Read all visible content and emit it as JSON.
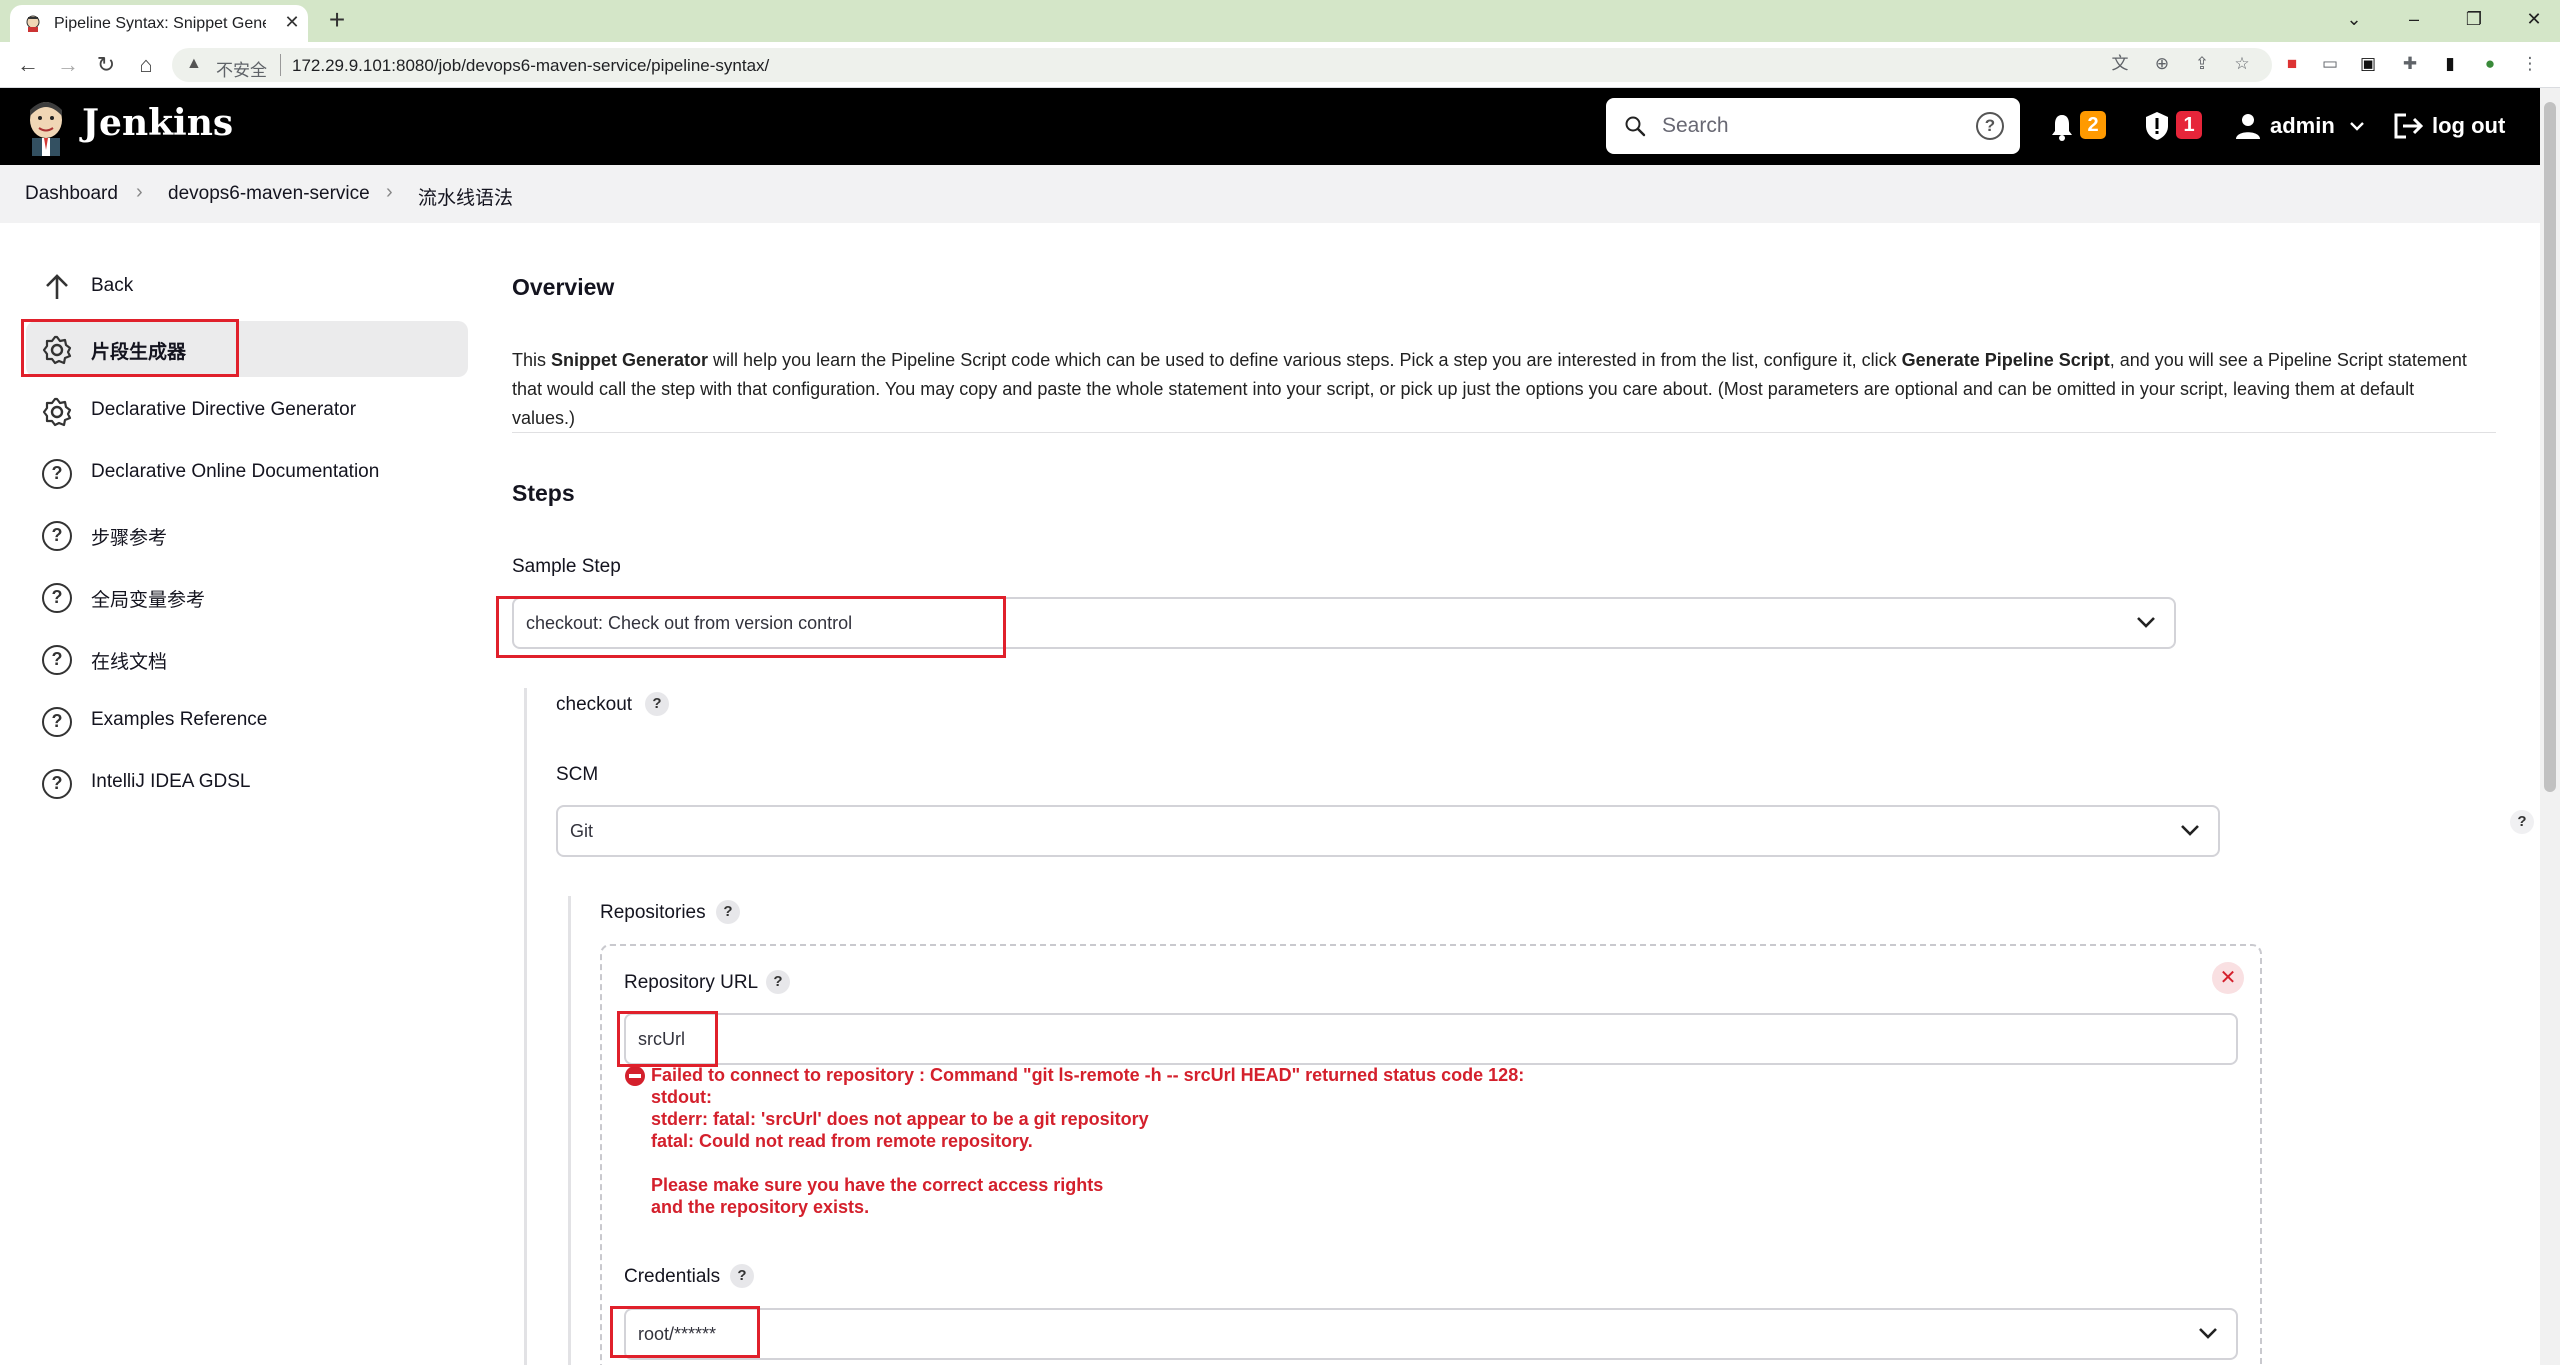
{
  "browser": {
    "tab_title": "Pipeline Syntax: Snippet Generator",
    "security_label": "不安全",
    "url": "172.29.9.101:8080/job/devops6-maven-service/pipeline-syntax/"
  },
  "header": {
    "brand": "Jenkins",
    "search_placeholder": "Search",
    "notifications_count": "2",
    "security_count": "1",
    "user": "admin",
    "logout": "log out"
  },
  "breadcrumb": [
    "Dashboard",
    "devops6-maven-service",
    "流水线语法"
  ],
  "sidebar": {
    "items": [
      {
        "label": "Back"
      },
      {
        "label": "片段生成器"
      },
      {
        "label": "Declarative Directive Generator"
      },
      {
        "label": "Declarative Online Documentation"
      },
      {
        "label": "步骤参考"
      },
      {
        "label": "全局变量参考"
      },
      {
        "label": "在线文档"
      },
      {
        "label": "Examples Reference"
      },
      {
        "label": "IntelliJ IDEA GDSL"
      }
    ]
  },
  "main": {
    "overview_title": "Overview",
    "overview_p1": "This ",
    "overview_b1": "Snippet Generator",
    "overview_p2": " will help you learn the Pipeline Script code which can be used to define various steps. Pick a step you are interested in from the list, configure it, click ",
    "overview_b2": "Generate Pipeline Script",
    "overview_p3": ", and you will see a Pipeline Script statement that would call the step with that configuration. You may copy and paste the whole statement into your script, or pick up just the options you care about. (Most parameters are optional and can be omitted in your script, leaving them at default values.)",
    "steps_title": "Steps",
    "sample_step_label": "Sample Step",
    "sample_step_value": "checkout: Check out from version control",
    "checkout_label": "checkout",
    "scm_label": "SCM",
    "scm_value": "Git",
    "repositories_label": "Repositories",
    "repo_url_label": "Repository URL",
    "repo_url_value": "srcUrl",
    "error_lines": [
      "Failed to connect to repository : Command \"git ls-remote -h -- srcUrl HEAD\" returned status code 128:",
      "stdout:",
      "stderr: fatal: 'srcUrl' does not appear to be a git repository",
      "fatal: Could not read from remote repository.",
      "",
      "Please make sure you have the correct access rights",
      "and the repository exists."
    ],
    "credentials_label": "Credentials",
    "credentials_value": "root/******",
    "help_symbol": "?",
    "remove_symbol": "✕"
  },
  "colors": {
    "error": "#d4202c",
    "highlight_box": "#e0202b",
    "notification_badge": "#ff9a00",
    "security_badge": "#e6253a"
  }
}
